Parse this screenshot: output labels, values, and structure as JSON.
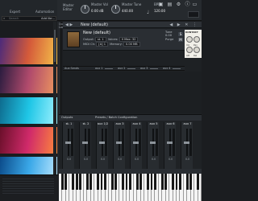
{
  "topbar": {
    "library_tabs": [
      "Expert",
      "Automation"
    ],
    "search_placeholder": "Search",
    "add_library_label": "Add libr...",
    "master_editor": "Master Editor",
    "master_vol_label": "Master Vol",
    "master_vol_value": "0.00 dB",
    "master_tune_label": "Master Tune",
    "master_tune_value": "440.00",
    "bpm_label": "BPM",
    "bpm_value": "120.00"
  },
  "rack": {
    "title": "New (default)",
    "tools": "◀ ▶ ✕ ⋮",
    "arrows": "◀ ▶",
    "instrument": {
      "name": "New (default)",
      "output_label": "Output:",
      "output_value": "st. 1",
      "midi_label": "MIDI Ch:",
      "midi_value": "[A] 1",
      "voices_label": "Voices:",
      "voices_value": "0 Max: 32",
      "memory_label": "Memory:",
      "memory_value": "0.00 MB",
      "purge": "Purge",
      "tune_label": "Tune",
      "tune_value": "0.00",
      "pan_label": "Pan",
      "s_btn": "S",
      "m_btn": "M"
    },
    "aux": [
      "Aux Sends",
      "aux 1",
      "aux 2",
      "aux 3",
      "aux 4"
    ]
  },
  "logo_panel": {
    "brand": "KONTAKT",
    "knob_labels": [
      "Vol",
      "Pan",
      "Att",
      "Rel"
    ]
  },
  "outputs": {
    "title": "Outputs",
    "selector": "Presets / Batch Configuration",
    "strips": [
      {
        "name": "st. 1",
        "db": "0.0"
      },
      {
        "name": "st. 2",
        "db": "0.0"
      },
      {
        "name": "aux 1/2",
        "db": "0.0"
      },
      {
        "name": "aux 3",
        "db": "0.0"
      },
      {
        "name": "aux 4",
        "db": "0.0"
      },
      {
        "name": "aux 5",
        "db": "0.0"
      },
      {
        "name": "aux 6",
        "db": "0.0"
      },
      {
        "name": "aux 7",
        "db": "0.0"
      }
    ]
  },
  "sidebar": {
    "labels": [
      "Quick",
      "Load"
    ]
  },
  "colors": {
    "lib_gradients": [
      "linear-gradient(100deg,#4b2a7a,#d45a3a,#f5c24a)",
      "linear-gradient(100deg,#2a1c3f,#b04a6c,#f09a5e)",
      "linear-gradient(100deg,#0e6b8e,#1fc6e6,#9ff2ff)",
      "linear-gradient(100deg,#6a0f2a,#d02a6a,#ff8a3a)",
      "linear-gradient(100deg,#0b4b8a,#3aa8e8,#bde8ff)",
      "linear-gradient(100deg,#1a2a3a,#3a5a7a,#8ab0c8)"
    ]
  }
}
